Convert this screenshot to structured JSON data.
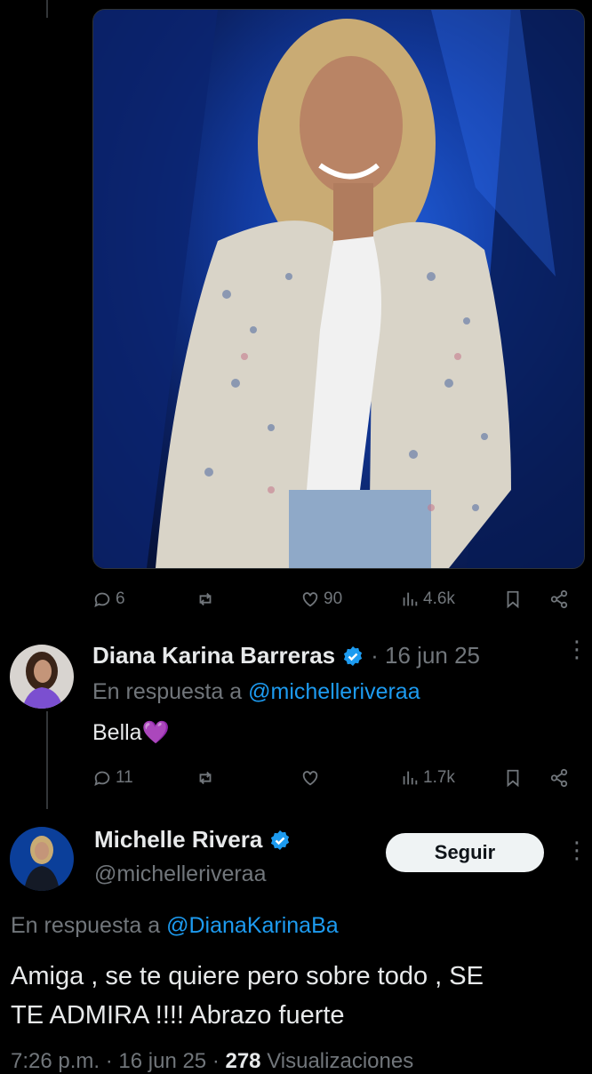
{
  "first_tweet": {
    "stats": {
      "replies": "6",
      "likes": "90",
      "views": "4.6k"
    }
  },
  "reply_tweet": {
    "author": "Diana Karina Barreras",
    "date": "· 16 jun 25",
    "reply_prefix": "En respuesta a",
    "reply_handle": "@michelleriveraa",
    "text": "Bella💜",
    "stats": {
      "replies": "11",
      "views": "1.7k"
    }
  },
  "main_tweet": {
    "author": "Michelle Rivera",
    "handle": "@michelleriveraa",
    "follow_label": "Seguir",
    "reply_prefix": "En respuesta a",
    "reply_handle": "@DianaKarinaBa",
    "text_line1": "Amiga , se te quiere pero sobre todo , SE",
    "text_line2": "TE ADMIRA !!!! Abrazo fuerte",
    "meta_time": "7:26 p.m.",
    "meta_date": "· 16 jun 25 ·",
    "meta_views": "278",
    "meta_views_label": "Visualizaciones"
  },
  "icons": {
    "reply": "comment-icon",
    "repost": "repost-icon",
    "like": "heart-icon",
    "views": "views-icon",
    "bookmark": "bookmark-icon",
    "share": "share-icon",
    "verified": "verified-badge-icon",
    "more": "more-icon"
  },
  "colors": {
    "accent": "#1d9bf0",
    "muted": "#71767b",
    "background": "#000000",
    "text": "#e7e9ea"
  }
}
